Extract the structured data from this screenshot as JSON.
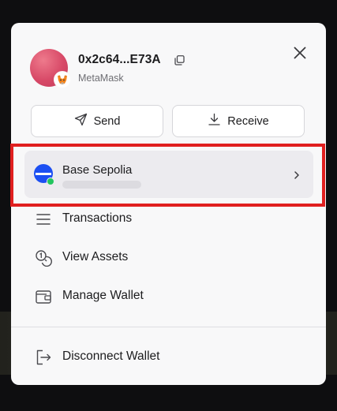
{
  "account": {
    "address": "0x2c64...E73A",
    "wallet_name": "MetaMask"
  },
  "actions": {
    "send_label": "Send",
    "receive_label": "Receive"
  },
  "network": {
    "name": "Base Sepolia",
    "status_color": "#22c55e",
    "brand_color": "#1c4ff2"
  },
  "menu": {
    "transactions_label": "Transactions",
    "view_assets_label": "View Assets",
    "manage_wallet_label": "Manage Wallet",
    "disconnect_label": "Disconnect Wallet"
  },
  "annotation": {
    "highlight_color": "#e01f1f"
  }
}
